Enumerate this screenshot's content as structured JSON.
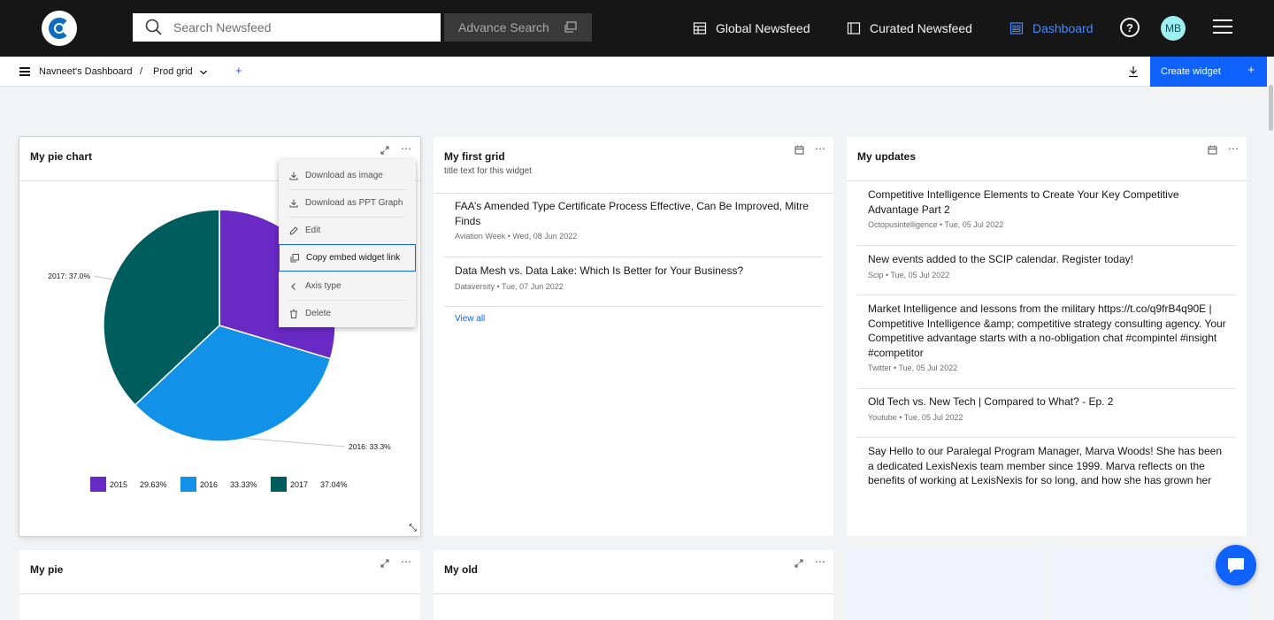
{
  "topbar": {
    "search_placeholder": "Search Newsfeed",
    "advance_search_label": "Advance Search",
    "nav": {
      "global_newsfeed": "Global Newsfeed",
      "curated_newsfeed": "Curated Newsfeed",
      "dashboard": "Dashboard"
    },
    "help_label": "?",
    "avatar_initials": "MB",
    "active_color": "#4589ff"
  },
  "breadcrumb": {
    "dashboard_name": "Navneet's Dashboard",
    "separator": "/",
    "grid_name": "Prod grid",
    "add_label": "+",
    "create_widget_label": "Create widget",
    "create_widget_plus": "+",
    "accent_color": "#0f62fe"
  },
  "pie_widget": {
    "title": "My pie chart",
    "callouts": {
      "2017": "2017: 37.0%",
      "2016": "2016: 33.3%"
    },
    "legend": [
      {
        "label": "2015",
        "pct": "29.63%",
        "color": "#6929c4"
      },
      {
        "label": "2016",
        "pct": "33.33%",
        "color": "#1192e8"
      },
      {
        "label": "2017",
        "pct": "37.04%",
        "color": "#005d5d"
      }
    ],
    "menu": {
      "download_image": "Download as image",
      "download_ppt": "Download as PPT Graph",
      "edit": "Edit",
      "copy_embed": "Copy embed widget link",
      "axis_type": "Axis type",
      "delete": "Delete"
    }
  },
  "chart_data": {
    "type": "pie",
    "categories": [
      "2015",
      "2016",
      "2017"
    ],
    "values": [
      29.63,
      33.33,
      37.04
    ],
    "colors": [
      "#6929c4",
      "#1192e8",
      "#005d5d"
    ],
    "title": "My pie chart",
    "legend_position": "bottom"
  },
  "grid_widget": {
    "title": "My first grid",
    "subtitle": "title text for this widget",
    "items": [
      {
        "title": "FAA’s Amended Type Certificate Process Effective, Can Be Improved, Mitre Finds",
        "meta": "Aviation Week • Wed, 08 Jun 2022"
      },
      {
        "title": "Data Mesh vs. Data Lake: Which Is Better for Your Business?",
        "meta": "Dataversity • Tue, 07 Jun 2022"
      }
    ],
    "view_all": "View all"
  },
  "updates_widget": {
    "title": "My updates",
    "items": [
      {
        "title": "Competitive Intelligence Elements to Create Your Key Competitive Advantage Part 2",
        "meta": "Octopusintelligence • Tue, 05 Jul 2022"
      },
      {
        "title": "New events added to the SCIP calendar. Register today!",
        "meta": "Scip • Tue, 05 Jul 2022"
      },
      {
        "title": "Market Intelligence and lessons from the military https://t.co/q9frB4q90E | Competitive Intelligence &amp; competitive strategy consulting agency. Your Competitive advantage starts with a no-obligation chat #compintel #insight #competitor",
        "meta": "Twitter • Tue, 05 Jul 2022"
      },
      {
        "title": "Old Tech vs. New Tech | Compared to What? - Ep. 2",
        "meta": "Youtube • Tue, 05 Jul 2022"
      },
      {
        "title": "Say Hello to our Paralegal Program Manager, Marva Woods! She has been a dedicated LexisNexis team member since 1999. Marva reflects on the benefits of working at LexisNexis for so long, and how she has grown her",
        "meta": ""
      }
    ]
  },
  "bottom_widgets": {
    "pie_title": "My pie",
    "old_title": "My old"
  }
}
